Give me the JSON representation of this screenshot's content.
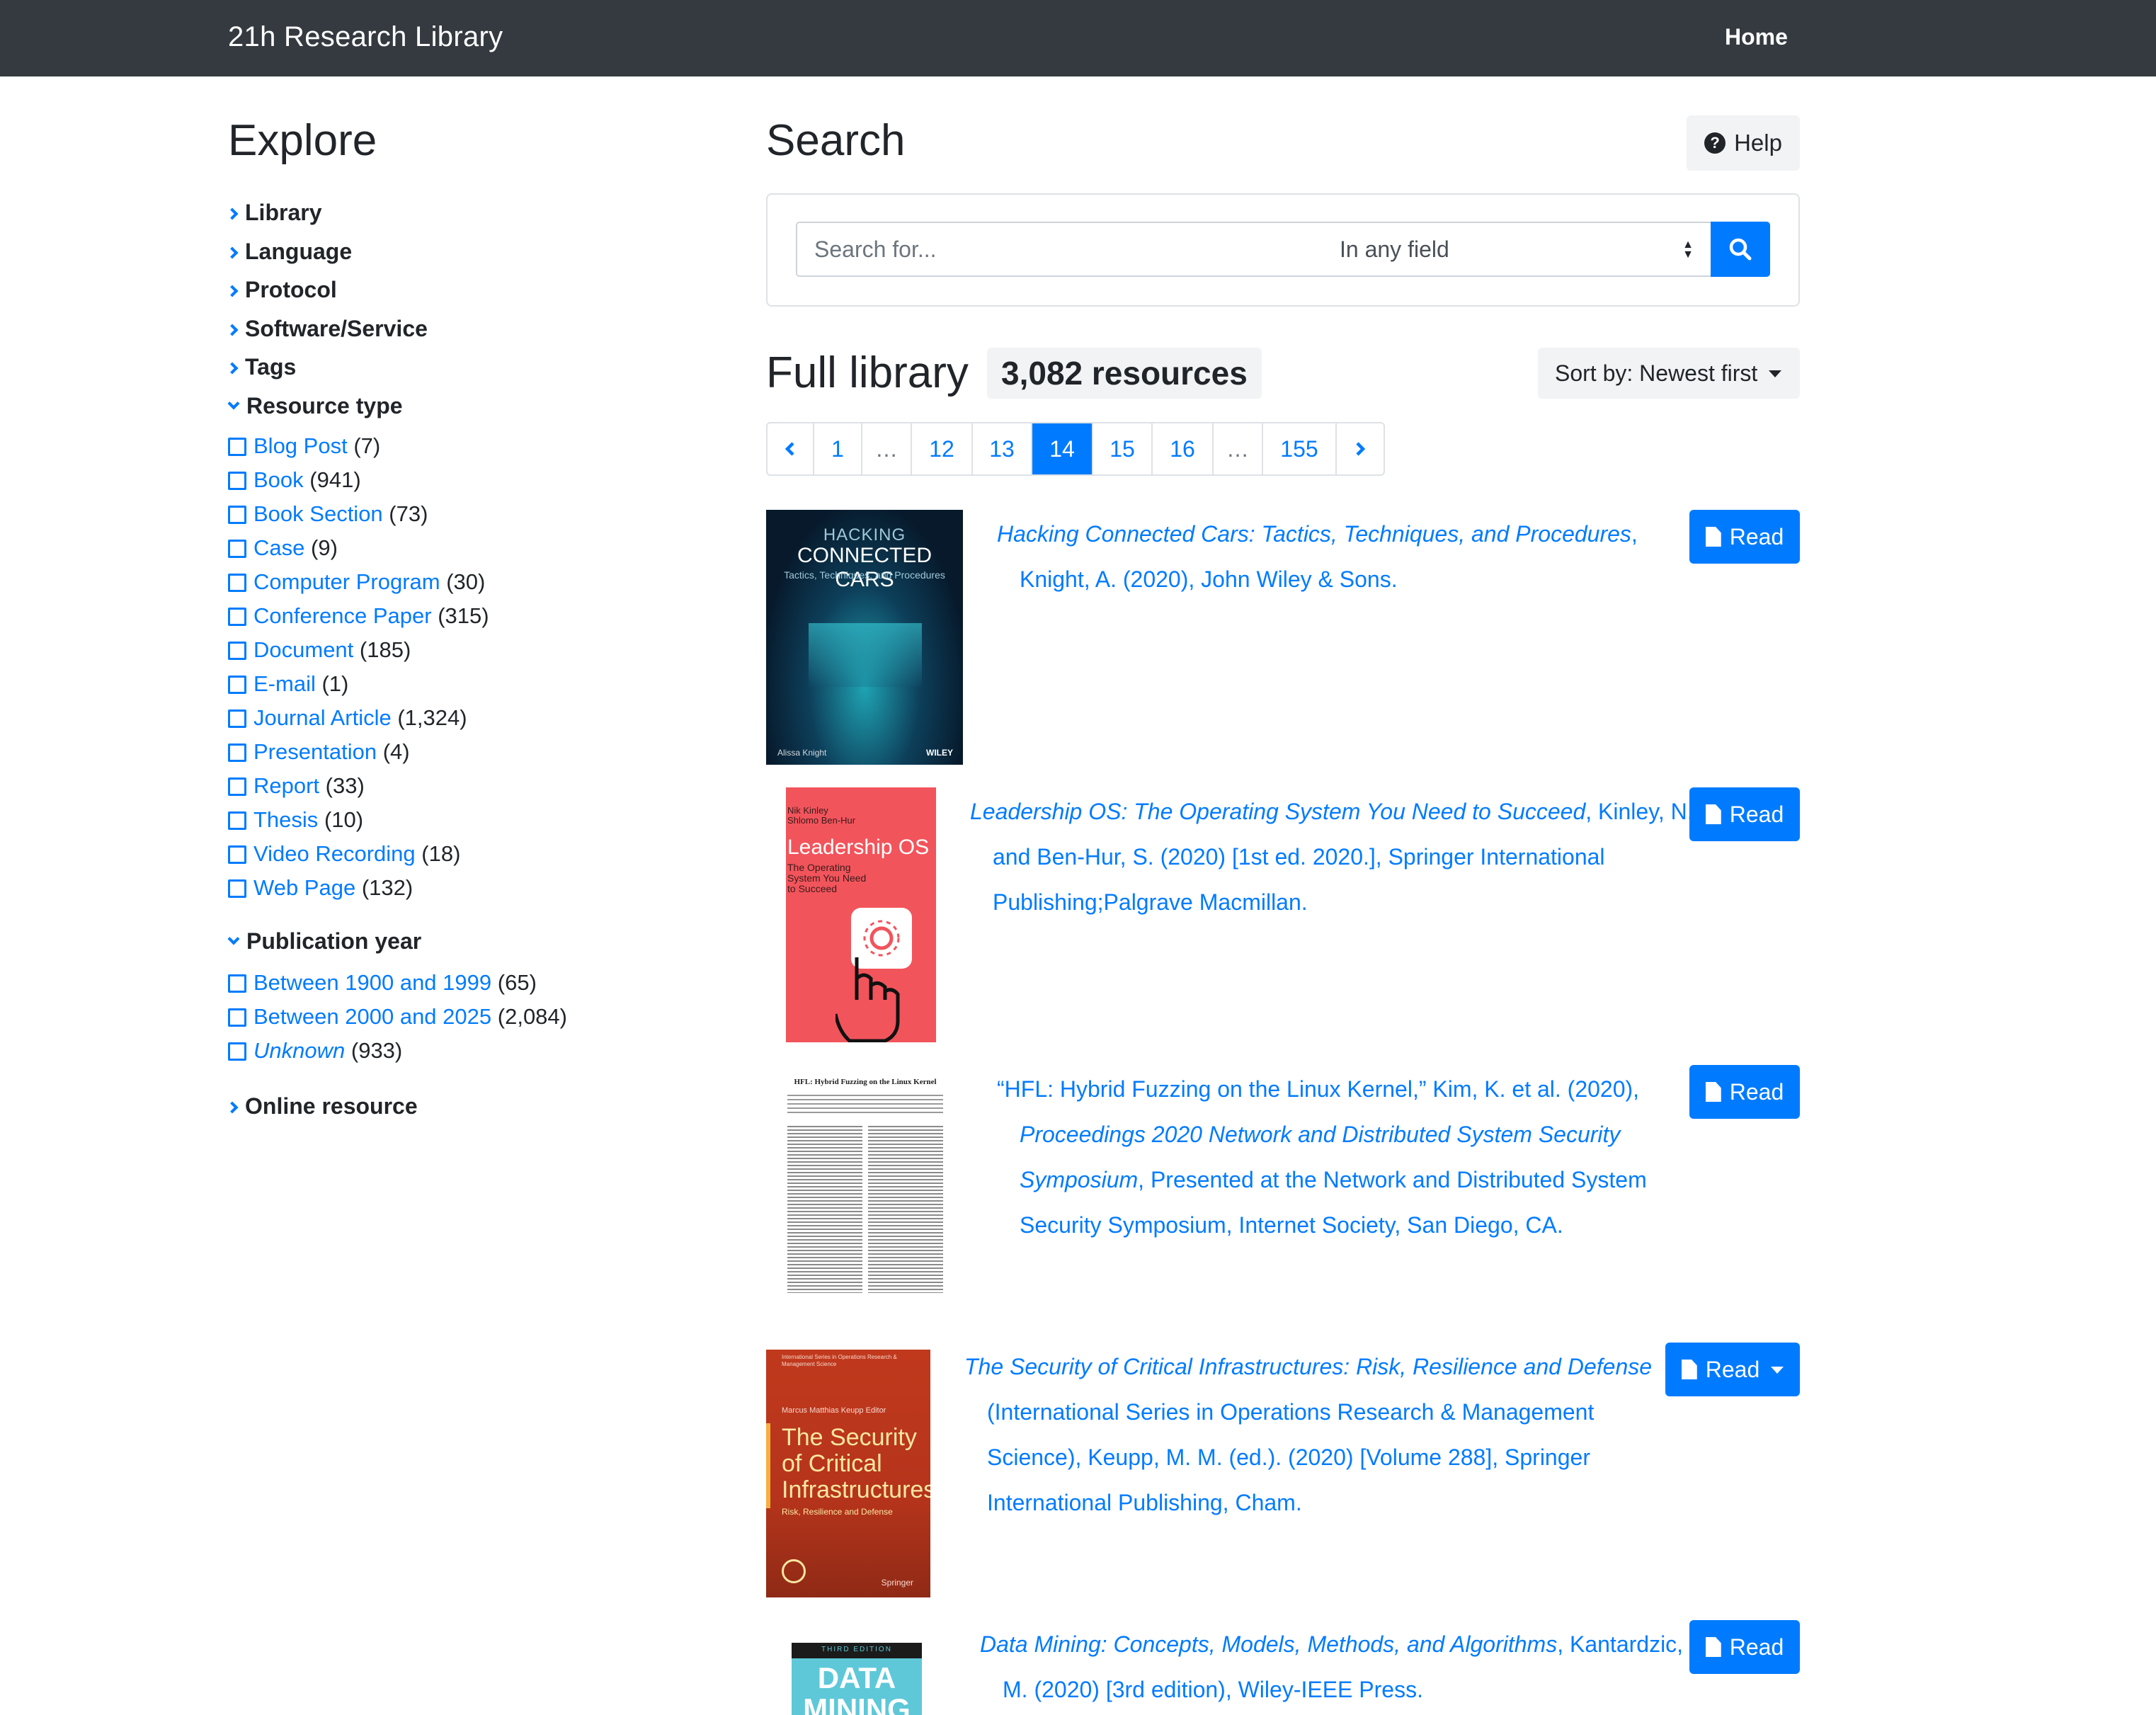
{
  "nav": {
    "brand": "21h Research Library",
    "home": "Home"
  },
  "sidebar": {
    "title": "Explore",
    "facets_top": [
      {
        "label": "Library"
      },
      {
        "label": "Language"
      },
      {
        "label": "Protocol"
      },
      {
        "label": "Software/Service"
      },
      {
        "label": "Tags"
      }
    ],
    "resource_type": {
      "label": "Resource type",
      "options": [
        {
          "label": "Blog Post",
          "count": "(7)"
        },
        {
          "label": "Book",
          "count": "(941)"
        },
        {
          "label": "Book Section",
          "count": "(73)"
        },
        {
          "label": "Case",
          "count": "(9)"
        },
        {
          "label": "Computer Program",
          "count": "(30)"
        },
        {
          "label": "Conference Paper",
          "count": "(315)"
        },
        {
          "label": "Document",
          "count": "(185)"
        },
        {
          "label": "E-mail",
          "count": "(1)"
        },
        {
          "label": "Journal Article",
          "count": "(1,324)"
        },
        {
          "label": "Presentation",
          "count": "(4)"
        },
        {
          "label": "Report",
          "count": "(33)"
        },
        {
          "label": "Thesis",
          "count": "(10)"
        },
        {
          "label": "Video Recording",
          "count": "(18)"
        },
        {
          "label": "Web Page",
          "count": "(132)"
        }
      ]
    },
    "publication_year": {
      "label": "Publication year",
      "options": [
        {
          "label": "Between 1900 and 1999",
          "count": "(65)"
        },
        {
          "label": "Between 2000 and 2025",
          "count": "(2,084)"
        },
        {
          "label": "Unknown",
          "count": "(933)"
        }
      ]
    },
    "online_resource": "Online resource"
  },
  "search": {
    "title": "Search",
    "help": "Help",
    "placeholder": "Search for...",
    "field_select": "In any field"
  },
  "results": {
    "title": "Full library",
    "count": "3,082 resources",
    "sort": "Sort by: Newest first",
    "pages": [
      "1",
      "…",
      "12",
      "13",
      "14",
      "15",
      "16",
      "…",
      "155"
    ],
    "active_page": "14",
    "read_label": "Read",
    "items": [
      {
        "title": "Hacking Connected Cars: Tactics, Techniques, and Procedures",
        "rest_line1": ",",
        "line2": "Knight, A. (2020), John Wiley & Sons.",
        "cover": {
          "top": "HACKING",
          "main": "CONNECTED CARS",
          "sub": "Tactics, Techniques, and Procedures",
          "author": "Alissa Knight",
          "publisher": "WILEY"
        }
      },
      {
        "title": "Leadership OS: The Operating System You Need to Succeed",
        "rest_line1": ", Kinley, N.",
        "line2": "and Ben-Hur, S. (2020) [1st ed. 2020.], Springer International",
        "line3": "Publishing;Palgrave Macmillan.",
        "cover": {
          "authors1": "Nik Kinley",
          "authors2": "Shlomo Ben-Hur",
          "main": "Leadership OS",
          "sub1": "The Operating",
          "sub2": "System You Need",
          "sub3": "to Succeed"
        }
      },
      {
        "line1": "“HFL: Hybrid Fuzzing on the Linux Kernel,” Kim, K. et al. (2020),",
        "line2_italic": "Proceedings 2020 Network and Distributed System Security",
        "line3_italic": "Symposium",
        "line3_rest": ", Presented at the Network and Distributed System",
        "line4": "Security Symposium, Internet Society, San Diego, CA.",
        "cover": {
          "paper_title": "HFL: Hybrid Fuzzing on the Linux Kernel"
        }
      },
      {
        "title": "The Security of Critical Infrastructures: Risk, Resilience and Defense",
        "line2": "(International Series in Operations Research & Management",
        "line3": "Science), Keupp, M. M. (ed.). (2020) [Volume 288], Springer",
        "line4": "International Publishing, Cham.",
        "cover": {
          "series": "International Series in Operations Research & Management Science",
          "editor": "Marcus Matthias Keupp  Editor",
          "main1": "The Security",
          "main2": "of Critical",
          "main3": "Infrastructures",
          "sub": "Risk, Resilience and Defense",
          "publisher": "Springer"
        }
      },
      {
        "title": "Data Mining: Concepts, Models, Methods, and Algorithms",
        "rest_line1": ", Kantardzic,",
        "line2": "M. (2020) [3rd edition), Wiley-IEEE Press.",
        "cover": {
          "edition": "THIRD EDITION",
          "main": "DATA MINING"
        }
      }
    ]
  },
  "colors": {
    "navbar": "#343a40",
    "accent": "#007bff",
    "text": "#212529",
    "light_bg": "#f1f3f5"
  }
}
